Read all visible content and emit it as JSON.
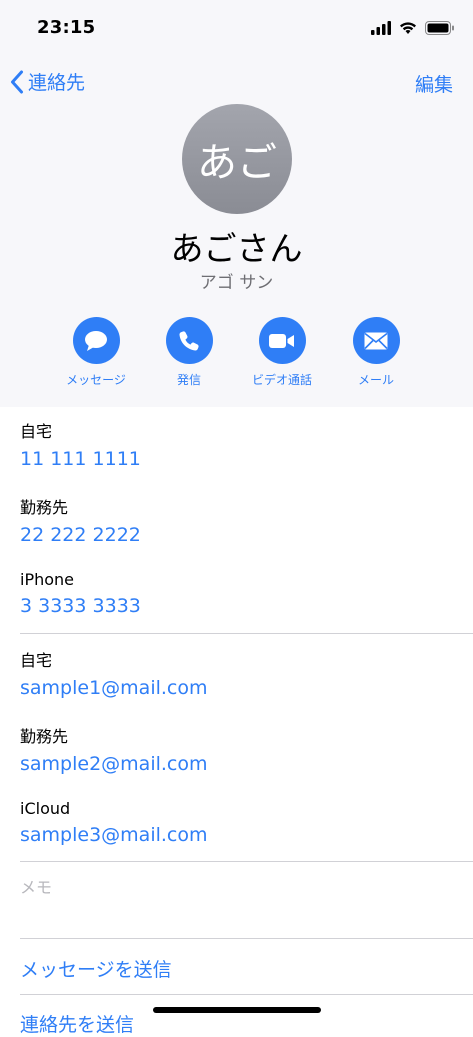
{
  "status_bar": {
    "time": "23:15",
    "icons": [
      "signal-icon",
      "wifi-icon",
      "battery-icon"
    ]
  },
  "nav": {
    "back_label": "連絡先",
    "edit_label": "編集"
  },
  "contact": {
    "avatar_initials": "あご",
    "name": "あごさん",
    "reading": "アゴ サン"
  },
  "actions": [
    {
      "label": "メッセージ",
      "icon": "message-bubble-icon"
    },
    {
      "label": "発信",
      "icon": "phone-icon"
    },
    {
      "label": "ビデオ通話",
      "icon": "video-camera-icon"
    },
    {
      "label": "メール",
      "icon": "mail-envelope-icon"
    }
  ],
  "phones": [
    {
      "label": "自宅",
      "value": "11 111 1111"
    },
    {
      "label": "勤務先",
      "value": "22 222 2222"
    },
    {
      "label": "iPhone",
      "value": "3 3333 3333"
    }
  ],
  "emails": [
    {
      "label": "自宅",
      "value": "sample1@mail.com"
    },
    {
      "label": "勤務先",
      "value": "sample2@mail.com"
    },
    {
      "label": "iCloud",
      "value": "sample3@mail.com"
    }
  ],
  "memo": {
    "label": "メモ"
  },
  "links": {
    "send_message": "メッセージを送信",
    "share_contact": "連絡先を送信"
  },
  "colors": {
    "accent": "#2f7ef6",
    "header_bg": "#f7f7fa",
    "avatar": "#9a9ca4"
  }
}
